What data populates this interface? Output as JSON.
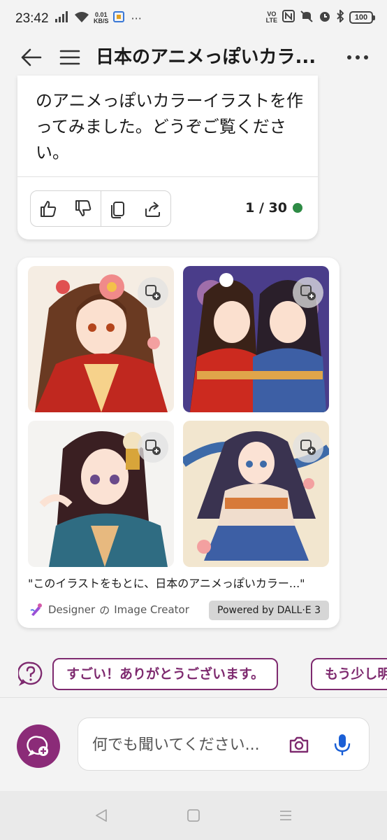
{
  "status_bar": {
    "time": "23:42",
    "net_speed_value": "0.01",
    "net_speed_unit": "KB/S",
    "more": "···",
    "volte_top": "VO",
    "volte_bottom": "LTE",
    "battery": "100"
  },
  "header": {
    "title": "日本のアニメっぽいカラ..."
  },
  "message": {
    "text": "のアニメっぽいカラーイラストを作ってみました。どうぞご覧ください。",
    "counter": "1 / 30",
    "status_color": "#2e8b45"
  },
  "image_card": {
    "prompt": "\"このイラストをもとに、日本のアニメっぽいカラー...\"",
    "designer_prefix": "Designer",
    "designer_mid": "の",
    "designer_suffix": "Image Creator",
    "powered_by": "Powered by DALL·E 3",
    "images": [
      {
        "icon": "add-to-collection-icon"
      },
      {
        "icon": "add-to-collection-icon"
      },
      {
        "icon": "add-to-collection-icon"
      },
      {
        "icon": "add-to-collection-icon"
      }
    ]
  },
  "suggestions": [
    "すごい！ありがとうございます。",
    "もう少し明"
  ],
  "composer": {
    "placeholder": "何でも聞いてください..."
  },
  "colors": {
    "accent": "#8b2b78",
    "chip_border": "#7e2a6f",
    "mic": "#1a5fd6",
    "background": "#f3f3f3"
  }
}
